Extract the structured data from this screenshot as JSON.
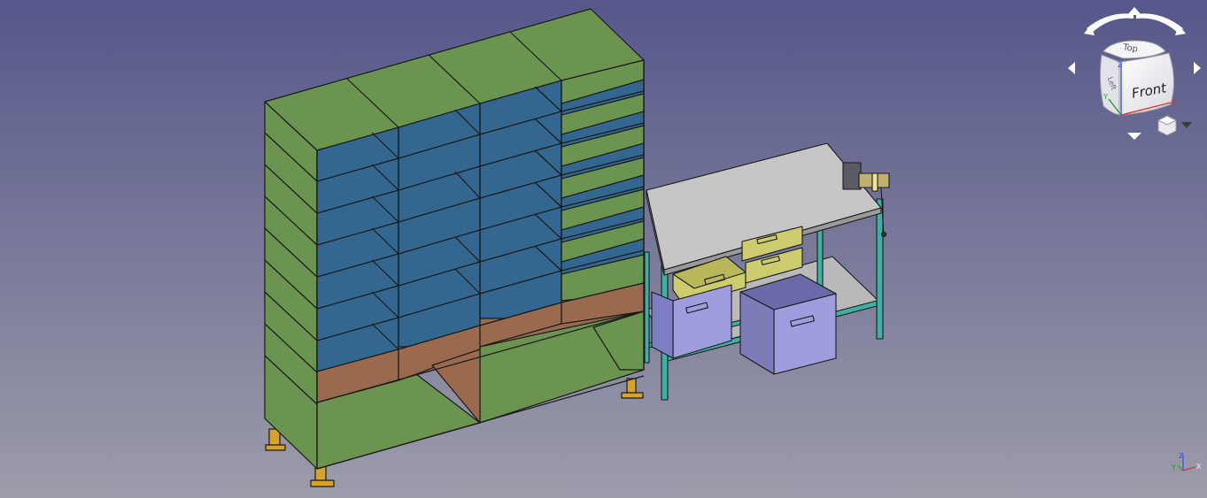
{
  "viewport": {
    "background_top": "#5a5b86",
    "background_bottom": "#9a9aa8"
  },
  "colors": {
    "frame_green": "#6b9450",
    "shelf_blue": "#33678f",
    "back_brown": "#9a6a4f",
    "bench_top_grey": "#c8c8c8",
    "bench_leg_teal": "#3fb0a6",
    "drawer_yellow": "#cccc6e",
    "bin_lavender": "#9e9ede",
    "foot_gold": "#d6a12c"
  },
  "navcube": {
    "face_front": "Front",
    "face_top": "Top",
    "face_left": "Left",
    "axis_x": "X",
    "axis_y": "Y",
    "axis_z": "Z",
    "rotate_icon": "rotate-arrows-icon",
    "menu_icon": "cube-menu-icon"
  },
  "axis_indicator": {
    "axis_x": "X",
    "axis_y": "Y",
    "axis_z": "Z"
  }
}
